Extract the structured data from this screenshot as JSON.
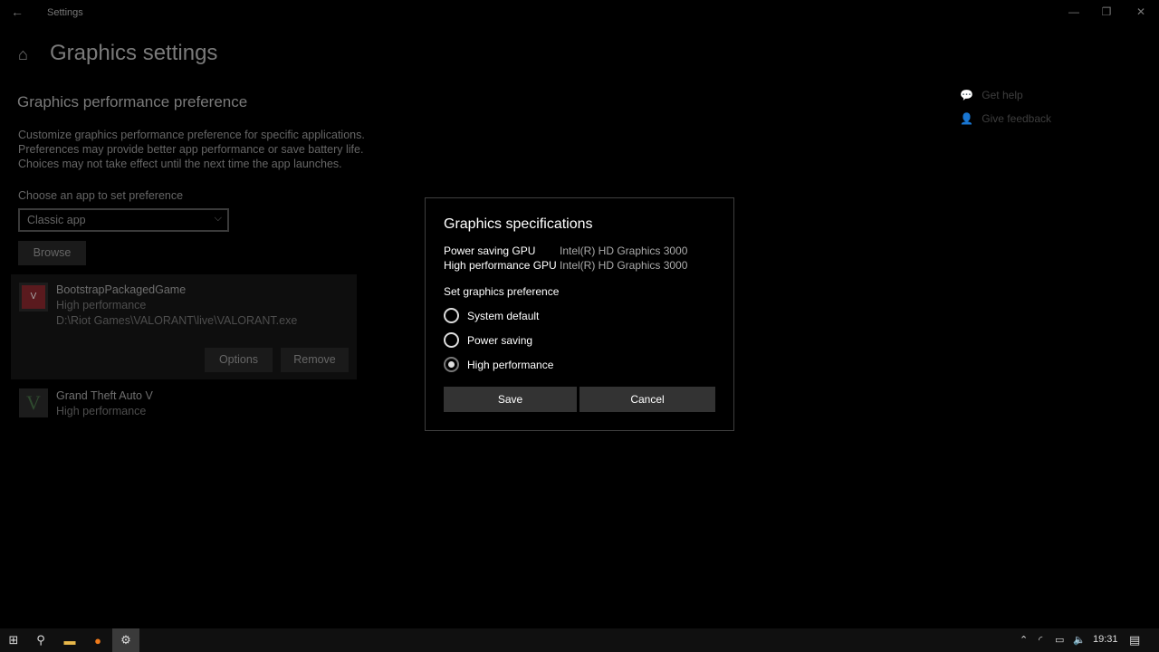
{
  "window": {
    "title": "Settings",
    "back": "←",
    "minimize": "—",
    "restore": "❐",
    "close": "✕"
  },
  "page": {
    "home_icon": "⌂",
    "title": "Graphics settings",
    "section": "Graphics performance preference",
    "description": [
      "Customize graphics performance preference for specific applications.",
      "Preferences may provide better app performance or save battery life.",
      "Choices may not take effect until the next time the app launches."
    ],
    "choose_label": "Choose an app to set preference",
    "app_type": "Classic app",
    "browse": "Browse"
  },
  "apps": [
    {
      "name": "BootstrapPackagedGame",
      "preference": "High performance",
      "path": "D:\\Riot Games\\VALORANT\\live\\VALORANT.exe",
      "options": "Options",
      "remove": "Remove"
    },
    {
      "name": "Grand Theft Auto V",
      "preference": "High performance"
    }
  ],
  "help": {
    "get_help": "Get help",
    "feedback": "Give feedback"
  },
  "dialog": {
    "title": "Graphics specifications",
    "specs": [
      {
        "label": "Power saving GPU",
        "value": "Intel(R) HD Graphics 3000"
      },
      {
        "label": "High performance GPU",
        "value": "Intel(R) HD Graphics 3000"
      }
    ],
    "pref_label": "Set graphics preference",
    "options": [
      "System default",
      "Power saving",
      "High performance"
    ],
    "selected": "High performance",
    "save": "Save",
    "cancel": "Cancel"
  },
  "taskbar": {
    "time": "19:31"
  }
}
